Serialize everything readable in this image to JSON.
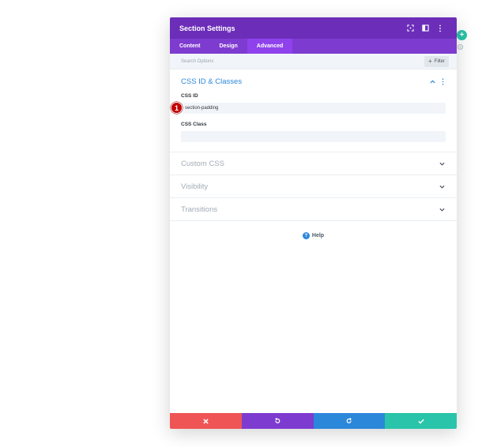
{
  "header": {
    "title": "Section Settings"
  },
  "tabs": [
    {
      "label": "Content",
      "active": false
    },
    {
      "label": "Design",
      "active": false
    },
    {
      "label": "Advanced",
      "active": true
    }
  ],
  "search": {
    "placeholder": "Search Options",
    "filter_label": "Filter"
  },
  "css_group": {
    "title": "CSS ID & Classes",
    "css_id_label": "CSS ID",
    "css_id_value": "section-padding",
    "css_class_label": "CSS Class",
    "css_class_value": "",
    "marker": "1"
  },
  "collapsed_groups": [
    "Custom CSS",
    "Visibility",
    "Transitions"
  ],
  "help": {
    "label": "Help"
  },
  "side": {
    "plus": "+"
  },
  "colors": {
    "header": "#6c2eb9",
    "tabs": "#7e3bd0",
    "tab_active": "#8f42ec",
    "accent_blue": "#2b87da",
    "cancel": "#ef5555",
    "undo": "#7e3bd0",
    "redo": "#2b87da",
    "save": "#29c4a9",
    "marker": "#c20000"
  },
  "icons": {
    "header": [
      "fullscreen-icon",
      "split-view-icon",
      "more-vertical-icon"
    ],
    "footer": [
      "close-icon",
      "undo-icon",
      "redo-icon",
      "check-icon"
    ]
  }
}
